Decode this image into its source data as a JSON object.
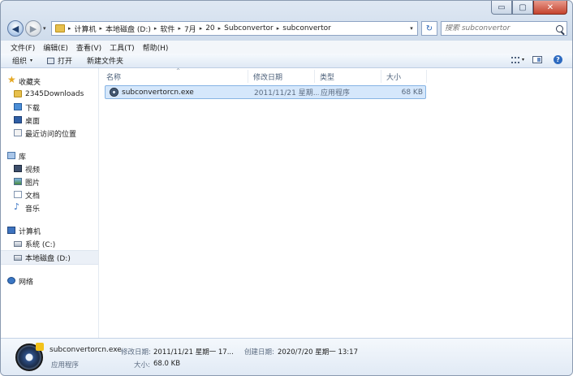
{
  "window": {
    "caption_buttons": {
      "minimize": "▭",
      "maximize": "▢",
      "close": "✕"
    }
  },
  "nav": {
    "back": "◀",
    "forward": "▶",
    "history_dropdown": "▾"
  },
  "address": {
    "crumbs": [
      "计算机",
      "本地磁盘 (D:)",
      "软件",
      "7月",
      "20",
      "Subconvertor",
      "subconvertor"
    ],
    "separator": "▸",
    "dropdown": "▾",
    "refresh": "↻"
  },
  "search": {
    "placeholder": "搜索 subconvertor"
  },
  "menubar": {
    "items": [
      "文件(F)",
      "编辑(E)",
      "查看(V)",
      "工具(T)",
      "帮助(H)"
    ]
  },
  "commandbar": {
    "organize": "组织",
    "open": "打开",
    "new_folder": "新建文件夹",
    "dropdown": "▾",
    "help": "?"
  },
  "sidebar": {
    "favorites": {
      "label": "收藏夹",
      "items": [
        "2345Downloads",
        "下载",
        "桌面",
        "最近访问的位置"
      ]
    },
    "libraries": {
      "label": "库",
      "items": [
        "视频",
        "图片",
        "文档",
        "音乐"
      ]
    },
    "computer": {
      "label": "计算机",
      "items": [
        "系统 (C:)",
        "本地磁盘 (D:)"
      ]
    },
    "network": {
      "label": "网络"
    }
  },
  "filelist": {
    "columns": [
      "名称",
      "修改日期",
      "类型",
      "大小"
    ],
    "sort_indicator": "^",
    "rows": [
      {
        "name": "subconvertorcn.exe",
        "modified": "2011/11/21 星期...",
        "type": "应用程序",
        "size": "68 KB"
      }
    ]
  },
  "details": {
    "filename": "subconvertorcn.exe",
    "filetype": "应用程序",
    "modified_label": "修改日期:",
    "modified_value": "2011/11/21 星期一 17...",
    "created_label": "创建日期:",
    "created_value": "2020/7/20 星期一 13:17",
    "size_label": "大小:",
    "size_value": "68.0 KB"
  }
}
